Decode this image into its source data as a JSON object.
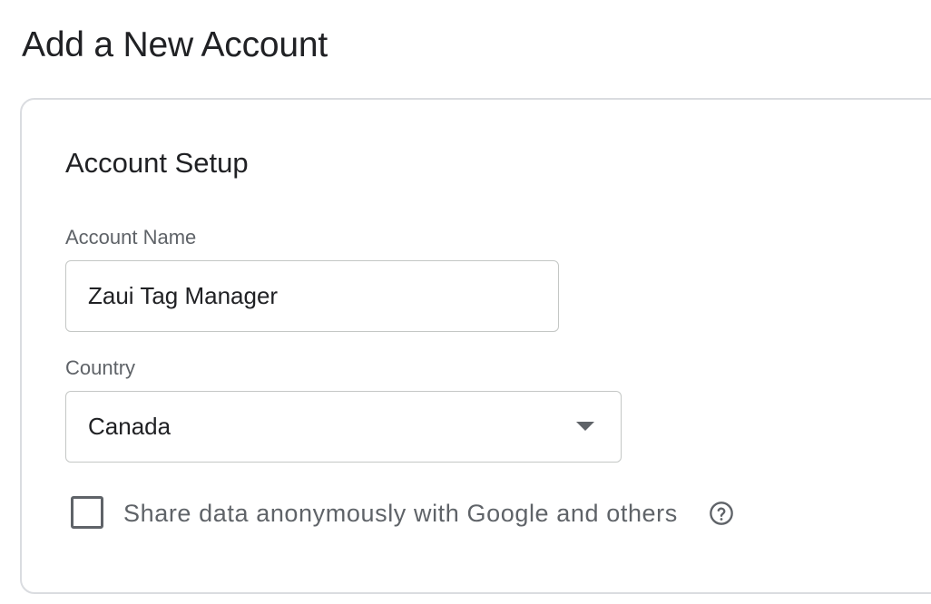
{
  "page": {
    "title": "Add a New Account"
  },
  "account_setup": {
    "section_title": "Account Setup",
    "account_name": {
      "label": "Account Name",
      "value": "Zaui Tag Manager"
    },
    "country": {
      "label": "Country",
      "selected": "Canada"
    },
    "share_data": {
      "label": "Share data anonymously with Google and others",
      "checked": false,
      "help_icon": "help-circle-outline-icon"
    }
  },
  "colors": {
    "text_primary": "#202124",
    "text_secondary": "#5f6368",
    "border": "#dadce0"
  }
}
